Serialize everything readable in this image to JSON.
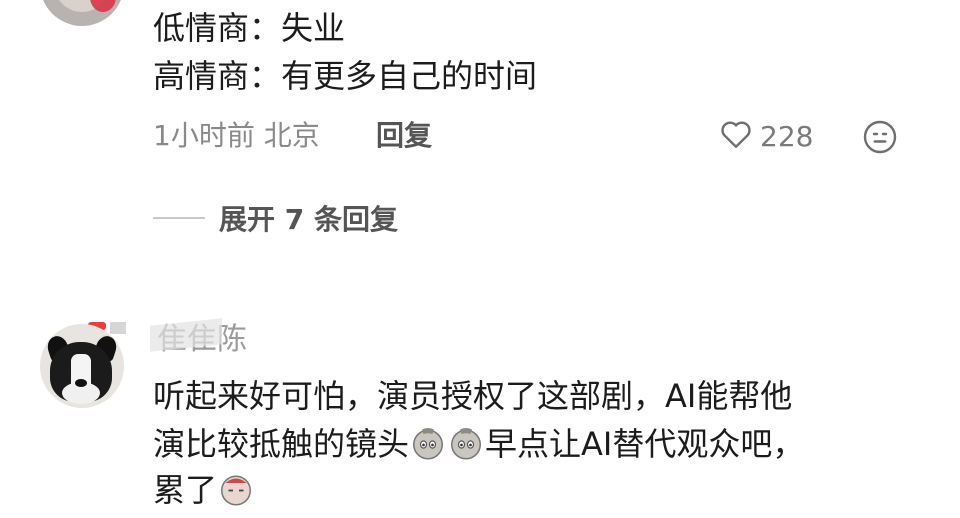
{
  "comment1": {
    "line1": "低情商：失业",
    "line2": "高情商：有更多自己的时间",
    "time_location": "1小时前 北京",
    "reply_label": "回复",
    "like_count": "228",
    "expand_label": "展开 7 条回复"
  },
  "comment2": {
    "username": "隹隹陈",
    "line1": "听起来好可怕，演员授权了这部剧，AI能帮他",
    "line2_a": "演比较抵触的镜头",
    "line2_b": "早点让AI替代观众吧，",
    "line3": "累了"
  },
  "icons": {
    "like": "heart-outline-icon",
    "emoji": "smiley-icon",
    "inline_emoji": "facepalm-emoji"
  },
  "colors": {
    "text_primary": "#1c1c1c",
    "text_secondary": "#8a8a8a",
    "reply": "#555555"
  }
}
